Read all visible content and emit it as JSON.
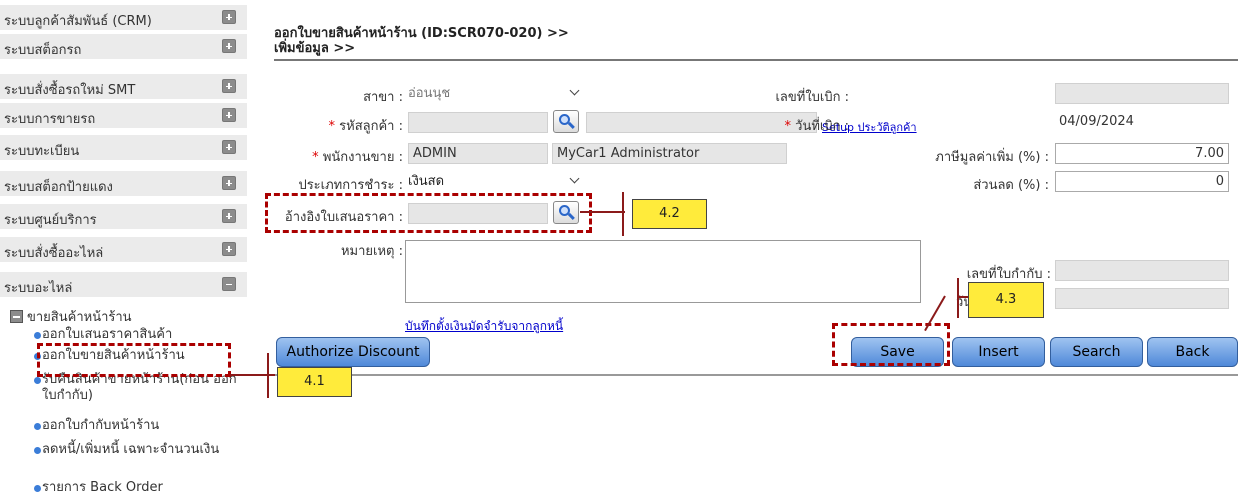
{
  "sidebar": {
    "items": [
      {
        "label": "ระบบลูกค้าสัมพันธ์ (CRM)",
        "state": "collapsed"
      },
      {
        "label": "ระบบสต็อกรถ",
        "state": "collapsed"
      },
      {
        "label": "ระบบสั่งซื้อรถใหม่ SMT",
        "state": "collapsed"
      },
      {
        "label": "ระบบการขายรถ",
        "state": "collapsed"
      },
      {
        "label": "ระบบทะเบียน",
        "state": "collapsed"
      },
      {
        "label": "ระบบสต็อกป้ายแดง",
        "state": "collapsed"
      },
      {
        "label": "ระบบศูนย์บริการ",
        "state": "collapsed"
      },
      {
        "label": "ระบบสั่งซื้ออะไหล่",
        "state": "collapsed"
      },
      {
        "label": "ระบบอะไหล่",
        "state": "expanded"
      }
    ],
    "subgroup": "ขายสินค้าหน้าร้าน",
    "subitems": [
      "ออกใบเสนอราคาสินค้า",
      "ออกใบขายสินค้าหน้าร้าน",
      "รับคืนสินค้าขายหน้าร้าน(ก่อน ออกใบกำกับ)",
      "ออกใบกำกับหน้าร้าน",
      "ลดหนี้/เพิ่มหนี้ เฉพาะจำนวนเงิน",
      "รายการ Back Order"
    ]
  },
  "page": {
    "title_line1": "ออกใบขายสินค้าหน้าร้าน (ID:SCR070-020) >>",
    "title_line2": "เพิ่มข้อมูล >>"
  },
  "form": {
    "branch_label": "สาขา :",
    "branch_value": "อ่อนนุช",
    "customer_code_label": "รหัสลูกค้า :",
    "setup_link": "Setup ประวัติลูกค้า",
    "salesperson_label": "พนักงานขาย :",
    "salesperson_code": "ADMIN",
    "salesperson_name": "MyCar1 Administrator",
    "payment_type_label": "ประเภทการชำระ :",
    "payment_type_value": "เงินสด",
    "quotation_ref_label": "อ้างอิงใบเสนอราคา :",
    "remark_label": "หมายเหตุ :",
    "deposit_link": "บันทึกตั้งเงินมัดจำรับจากลูกหนี้",
    "requisition_no_label": "เลขที่ใบเบิก :",
    "requisition_date_label": "วันที่เบิก :",
    "requisition_date_value": "04/09/2024",
    "vat_label": "ภาษีมูลค่าเพิ่ม (%) :",
    "vat_value": "7.00",
    "discount_label": "ส่วนลด (%) :",
    "discount_value": "0",
    "invoice_no_label": "เลขที่ใบกำกับ :",
    "invoice_date_label": "วันที่อ"
  },
  "buttons": {
    "authorize": "Authorize Discount",
    "save": "Save",
    "insert": "Insert",
    "search": "Search",
    "back": "Back"
  },
  "annotations": {
    "c41": "4.1",
    "c42": "4.2",
    "c43": "4.3"
  },
  "colors": {
    "sidebar_bg": "#ebebeb",
    "button_blue": "#4f89d9",
    "callout_yellow": "#ffeb3b",
    "dash_red": "#aa0000",
    "required_red": "#dd0000"
  }
}
